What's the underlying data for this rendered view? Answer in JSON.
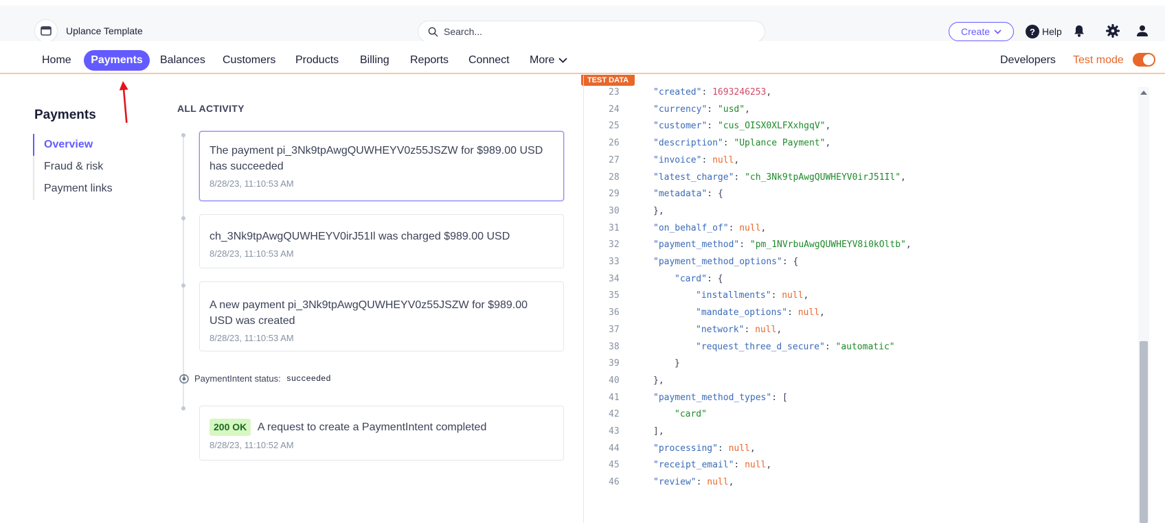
{
  "workspace": {
    "name": "Uplance Template"
  },
  "search": {
    "placeholder": "Search..."
  },
  "topbar": {
    "create_label": "Create",
    "help_label": "Help"
  },
  "nav": {
    "items": [
      "Home",
      "Payments",
      "Balances",
      "Customers",
      "Products",
      "Billing",
      "Reports",
      "Connect",
      "More"
    ],
    "active": "Payments",
    "developers_label": "Developers",
    "test_mode_label": "Test mode",
    "test_mode_on": true
  },
  "test_badge": "TEST DATA",
  "sidebar": {
    "title": "Payments",
    "items": [
      "Overview",
      "Fraud & risk",
      "Payment links"
    ],
    "active": "Overview"
  },
  "activity": {
    "title": "ALL ACTIVITY",
    "events": [
      {
        "text": "The payment pi_3Nk9tpAwgQUWHEYV0z55JSZW for $989.00 USD has succeeded",
        "time": "8/28/23, 11:10:53 AM"
      },
      {
        "text": "ch_3Nk9tpAwgQUWHEYV0irJ51Il was charged $989.00 USD",
        "time": "8/28/23, 11:10:53 AM"
      },
      {
        "text": "A new payment pi_3Nk9tpAwgQUWHEYV0z55JSZW for $989.00 USD was created",
        "time": "8/28/23, 11:10:53 AM"
      }
    ],
    "status_label": "PaymentIntent status:",
    "status_value": "succeeded",
    "request": {
      "badge": "200 OK",
      "text": "A request to create a PaymentIntent completed",
      "time": "8/28/23, 11:10:52 AM"
    }
  },
  "code": {
    "lines": [
      {
        "n": "23",
        "key": "created",
        "val": "1693246253",
        "vtype": "num",
        "tail": ","
      },
      {
        "n": "24",
        "key": "currency",
        "val": "\"usd\"",
        "vtype": "s",
        "tail": ","
      },
      {
        "n": "25",
        "key": "customer",
        "val": "\"cus_OISX0XLFXxhgqV\"",
        "vtype": "s",
        "tail": ","
      },
      {
        "n": "26",
        "key": "description",
        "val": "\"Uplance Payment\"",
        "vtype": "s",
        "tail": ","
      },
      {
        "n": "27",
        "key": "invoice",
        "val": "null",
        "vtype": "n",
        "tail": ","
      },
      {
        "n": "28",
        "key": "latest_charge",
        "val": "\"ch_3Nk9tpAwgQUWHEYV0irJ51Il\"",
        "vtype": "s",
        "tail": ","
      },
      {
        "n": "29",
        "key": "metadata",
        "val": "{",
        "vtype": "p",
        "tail": ""
      },
      {
        "n": "30",
        "key": "",
        "val": "},",
        "vtype": "p",
        "tail": ""
      },
      {
        "n": "31",
        "key": "on_behalf_of",
        "val": "null",
        "vtype": "n",
        "tail": ","
      },
      {
        "n": "32",
        "key": "payment_method",
        "val": "\"pm_1NVrbuAwgQUWHEYV8i0kOltb\"",
        "vtype": "s",
        "tail": ","
      },
      {
        "n": "33",
        "key": "payment_method_options",
        "val": "{",
        "vtype": "p",
        "tail": ""
      },
      {
        "n": "34",
        "key": "card",
        "val": "{",
        "vtype": "p",
        "tail": "",
        "indent": 1
      },
      {
        "n": "35",
        "key": "installments",
        "val": "null",
        "vtype": "n",
        "tail": ",",
        "indent": 2
      },
      {
        "n": "36",
        "key": "mandate_options",
        "val": "null",
        "vtype": "n",
        "tail": ",",
        "indent": 2
      },
      {
        "n": "37",
        "key": "network",
        "val": "null",
        "vtype": "n",
        "tail": ",",
        "indent": 2
      },
      {
        "n": "38",
        "key": "request_three_d_secure",
        "val": "\"automatic\"",
        "vtype": "s",
        "tail": "",
        "indent": 2
      },
      {
        "n": "39",
        "key": "",
        "val": "}",
        "vtype": "p",
        "tail": "",
        "indent": 1
      },
      {
        "n": "40",
        "key": "",
        "val": "},",
        "vtype": "p",
        "tail": ""
      },
      {
        "n": "41",
        "key": "payment_method_types",
        "val": "[",
        "vtype": "p",
        "tail": ""
      },
      {
        "n": "42",
        "key": "",
        "val": "\"card\"",
        "vtype": "s",
        "tail": "",
        "indent": 1
      },
      {
        "n": "43",
        "key": "",
        "val": "],",
        "vtype": "p",
        "tail": ""
      },
      {
        "n": "44",
        "key": "processing",
        "val": "null",
        "vtype": "n",
        "tail": ","
      },
      {
        "n": "45",
        "key": "receipt_email",
        "val": "null",
        "vtype": "n",
        "tail": ","
      },
      {
        "n": "46",
        "key": "review",
        "val": "null",
        "vtype": "n",
        "tail": ","
      }
    ]
  },
  "colors": {
    "accent": "#635bff",
    "test_mode": "#e8672a",
    "annotation": "#e3141c"
  }
}
